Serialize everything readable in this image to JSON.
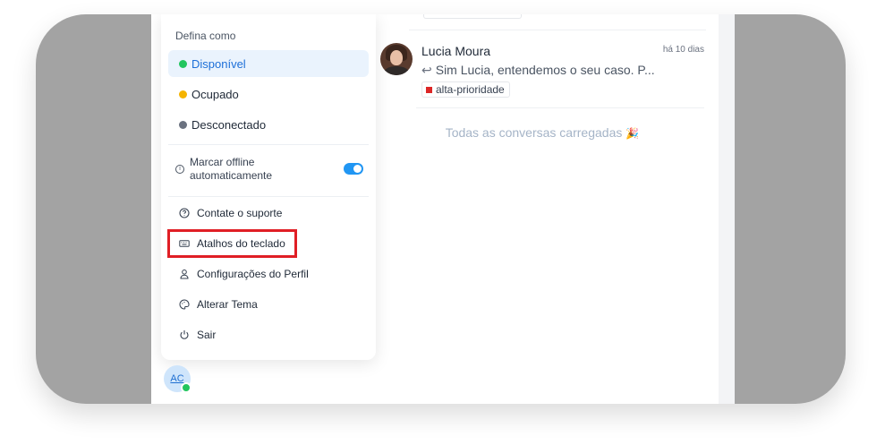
{
  "status_menu": {
    "title": "Defina como",
    "statuses": [
      {
        "label": "Disponível",
        "color": "#22c55e",
        "active": true
      },
      {
        "label": "Ocupado",
        "color": "#f5b400",
        "active": false
      },
      {
        "label": "Desconectado",
        "color": "#6b7280",
        "active": false
      }
    ],
    "auto_offline": {
      "label": "Marcar offline automaticamente",
      "enabled": true
    },
    "items": [
      {
        "label": "Contate o suporte",
        "icon": "chat-help-icon"
      },
      {
        "label": "Atalhos do teclado",
        "icon": "keyboard-icon"
      },
      {
        "label": "Configurações do Perfil",
        "icon": "user-icon"
      },
      {
        "label": "Alterar Tema",
        "icon": "palette-icon"
      },
      {
        "label": "Sair",
        "icon": "power-icon"
      }
    ]
  },
  "conversation": {
    "name": "Lucia Moura",
    "time": "há 10 dias",
    "preview": "Sim Lucia, entendemos o seu caso. P...",
    "label": "alta-prioridade",
    "label_color": "#dc2626"
  },
  "loaded_note": "Todas as conversas carregadas",
  "user_avatar": {
    "initials": "AC",
    "presence_color": "#22c55e"
  },
  "highlight_color": "#e01e25"
}
